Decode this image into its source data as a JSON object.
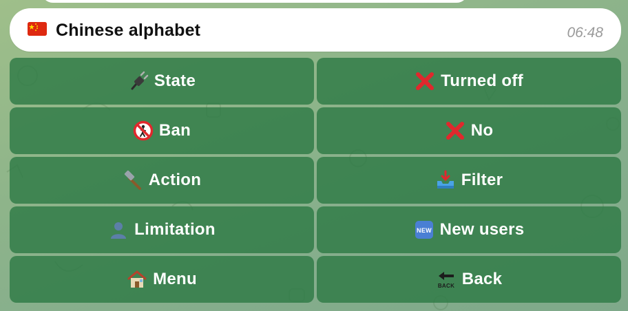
{
  "message": {
    "text": "Chinese alphabet",
    "time": "06:48",
    "flag_icon": "china-flag-icon"
  },
  "keyboard": {
    "rows": [
      [
        {
          "label": "State",
          "icon": "plug-icon"
        },
        {
          "label": "Turned off",
          "icon": "cross-mark-icon"
        }
      ],
      [
        {
          "label": "Ban",
          "icon": "no-pedestrians-icon"
        },
        {
          "label": "No",
          "icon": "cross-mark-icon"
        }
      ],
      [
        {
          "label": "Action",
          "icon": "hammer-icon"
        },
        {
          "label": "Filter",
          "icon": "inbox-tray-icon"
        }
      ],
      [
        {
          "label": "Limitation",
          "icon": "person-silhouette-icon"
        },
        {
          "label": "New users",
          "icon": "new-button-icon"
        }
      ],
      [
        {
          "label": "Menu",
          "icon": "house-icon"
        },
        {
          "label": "Back",
          "icon": "back-arrow-icon"
        }
      ]
    ]
  },
  "colors": {
    "button_bg": "#2e7a46",
    "cross_red": "#e0282d",
    "background": "#8fb58a"
  }
}
